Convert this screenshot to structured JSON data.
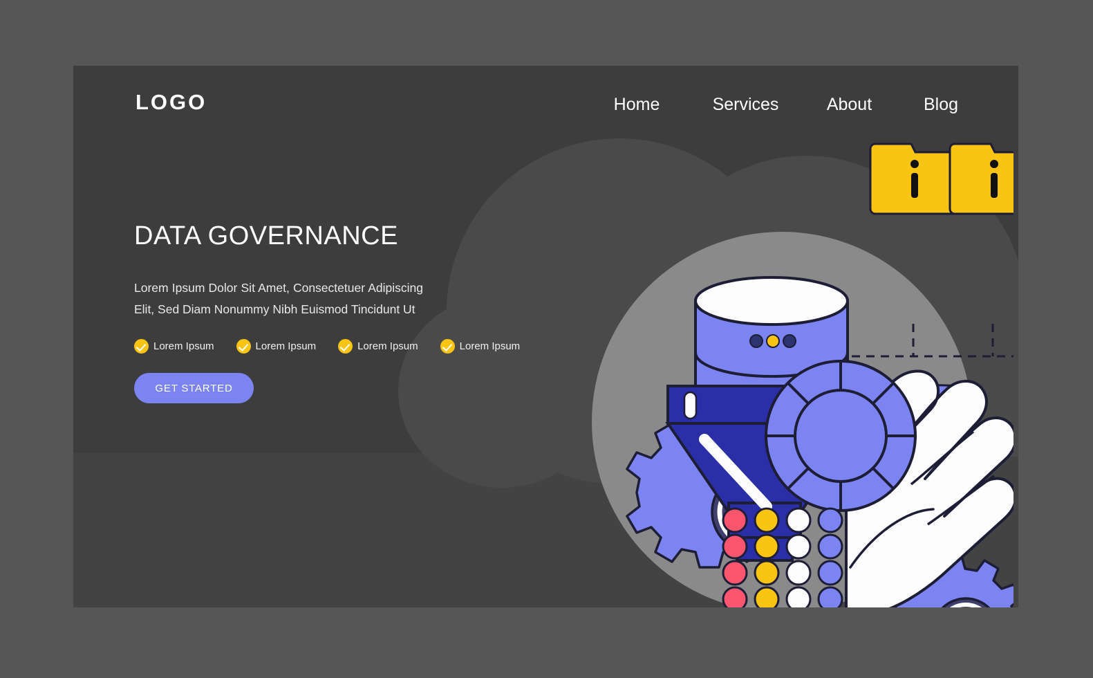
{
  "header": {
    "logo": "LOGO",
    "nav": [
      {
        "label": "Home"
      },
      {
        "label": "Services"
      },
      {
        "label": "About"
      },
      {
        "label": "Blog"
      }
    ]
  },
  "hero": {
    "title": "DATA GOVERNANCE",
    "subtitle": "Lorem Ipsum Dolor Sit Amet, Consectetuer Adipiscing Elit, Sed Diam Nonummy Nibh Euismod Tincidunt Ut",
    "features": [
      {
        "label": "Lorem Ipsum",
        "icon": "check-circle-icon"
      },
      {
        "label": "Lorem Ipsum",
        "icon": "check-circle-icon"
      },
      {
        "label": "Lorem Ipsum",
        "icon": "check-circle-icon"
      },
      {
        "label": "Lorem Ipsum",
        "icon": "check-circle-icon"
      }
    ],
    "cta_label": "GET STARTED"
  },
  "illustration": {
    "name": "data-governance-illustration",
    "elements": [
      "database-cylinder",
      "funnel",
      "folder-info-left",
      "folder-info-right",
      "shield-badge",
      "robot-hand",
      "gear-left",
      "gear-right",
      "dot-matrix",
      "pink-base"
    ],
    "folder_label": "i",
    "dot_matrix": {
      "rows": 5,
      "columns": 4,
      "colors": [
        "#f9556e",
        "#fac412",
        "#fdfdfd",
        "#7b84f0"
      ]
    }
  },
  "colors": {
    "page_background": "#565656",
    "panel_background": "#3d3d3d",
    "panel_lower": "#434343",
    "blob": "#4a4a4a",
    "accent_periwinkle": "#7b84f0",
    "accent_navy": "#2a2fa8",
    "accent_yellow": "#fac412",
    "accent_pink": "#f9556e",
    "illustration_backdrop": "#8a8a8a",
    "text_primary": "#ffffff",
    "outline": "#1d1d35"
  }
}
